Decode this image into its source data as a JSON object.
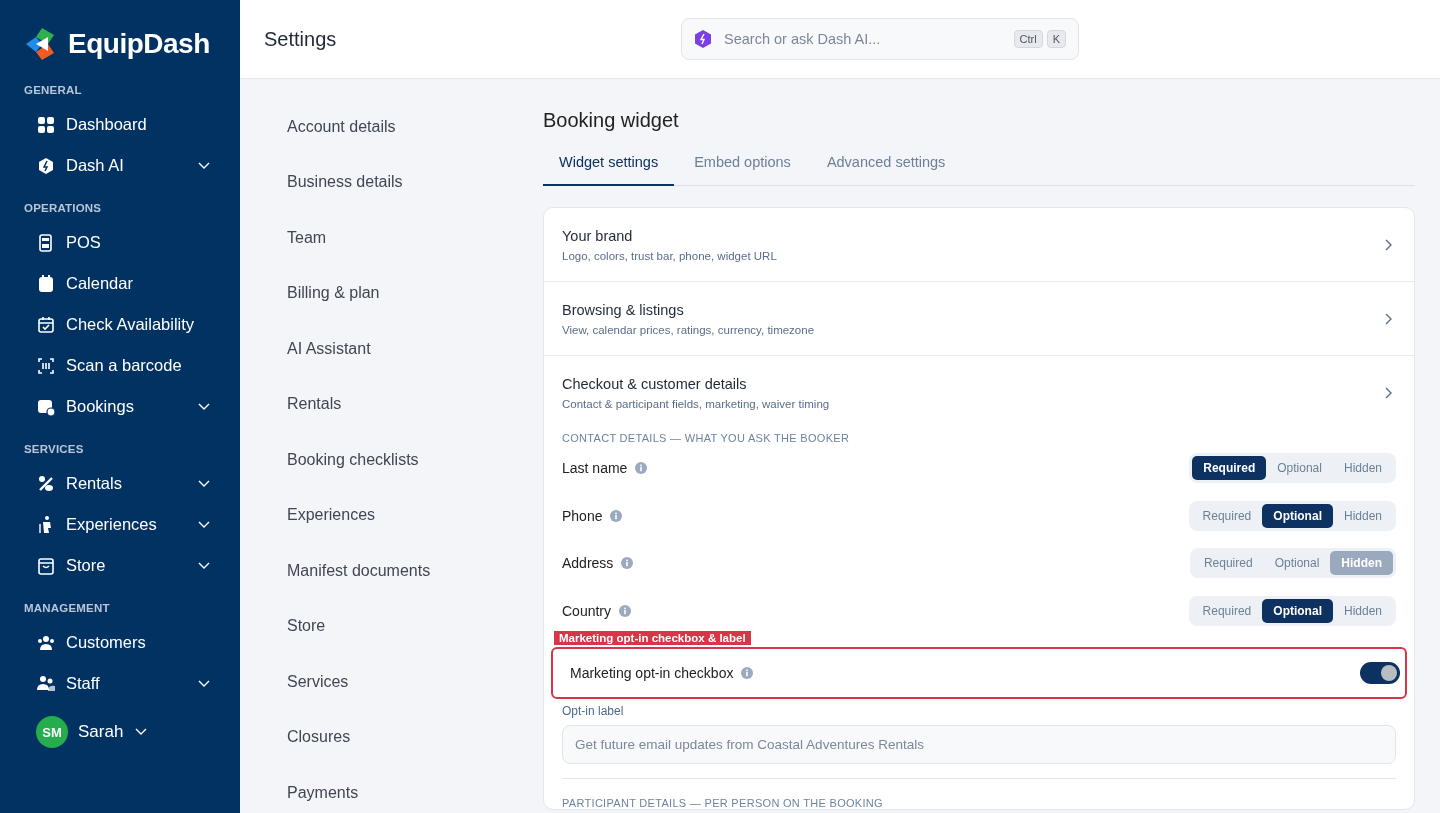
{
  "brand": {
    "name": "EquipDash"
  },
  "sidebar": {
    "sections": [
      {
        "title": "GENERAL",
        "items": [
          {
            "label": "Dashboard"
          },
          {
            "label": "Dash AI",
            "expanded": false
          }
        ]
      },
      {
        "title": "OPERATIONS",
        "items": [
          {
            "label": "POS"
          },
          {
            "label": "Calendar"
          },
          {
            "label": "Check Availability"
          },
          {
            "label": "Scan a barcode"
          },
          {
            "label": "Bookings",
            "expanded": false
          }
        ]
      },
      {
        "title": "SERVICES",
        "items": [
          {
            "label": "Rentals",
            "expanded": false
          },
          {
            "label": "Experiences",
            "expanded": false
          },
          {
            "label": "Store",
            "expanded": false
          }
        ]
      },
      {
        "title": "MANAGEMENT",
        "items": [
          {
            "label": "Customers"
          },
          {
            "label": "Staff",
            "expanded": false
          }
        ]
      }
    ],
    "user": {
      "initials": "SM",
      "name": "Sarah",
      "expanded": false
    }
  },
  "header": {
    "title": "Settings",
    "search": {
      "placeholder": "Search or ask Dash AI...",
      "keys": [
        "Ctrl",
        "K"
      ]
    }
  },
  "settings_nav": [
    "Account details",
    "Business details",
    "Team",
    "Billing & plan",
    "AI Assistant",
    "Rentals",
    "Booking checklists",
    "Experiences",
    "Manifest documents",
    "Store",
    "Services",
    "Closures",
    "Payments"
  ],
  "page": {
    "title": "Booking widget",
    "tabs": [
      {
        "label": "Widget settings",
        "selected": true
      },
      {
        "label": "Embed options",
        "selected": false
      },
      {
        "label": "Advanced settings",
        "selected": false
      }
    ],
    "panels": [
      {
        "title": "Your brand",
        "subtitle": "Logo, colors, trust bar, phone, widget URL"
      },
      {
        "title": "Browsing & listings",
        "subtitle": "View, calendar prices, ratings, currency, timezone"
      },
      {
        "title": "Checkout & customer details",
        "subtitle": "Contact & participant fields, marketing, waiver timing"
      }
    ],
    "contact_heading": "CONTACT DETAILS — WHAT YOU ASK THE BOOKER",
    "fields": [
      {
        "label": "Last name",
        "options": [
          {
            "label": "Required",
            "selected": true
          },
          {
            "label": "Optional",
            "selected": false
          },
          {
            "label": "Hidden",
            "selected": false
          }
        ]
      },
      {
        "label": "Phone",
        "options": [
          {
            "label": "Required",
            "selected": false
          },
          {
            "label": "Optional",
            "selected": true
          },
          {
            "label": "Hidden",
            "selected": false
          }
        ]
      },
      {
        "label": "Address",
        "options": [
          {
            "label": "Required",
            "selected": false
          },
          {
            "label": "Optional",
            "selected": false
          },
          {
            "label": "Hidden",
            "selected": true
          }
        ]
      },
      {
        "label": "Country",
        "options": [
          {
            "label": "Required",
            "selected": false
          },
          {
            "label": "Optional",
            "selected": true
          },
          {
            "label": "Hidden",
            "selected": false
          }
        ]
      }
    ],
    "annotation": "Marketing opt-in checkbox & label",
    "marketing": {
      "label": "Marketing opt-in checkbox",
      "on": true
    },
    "optin_label": {
      "label": "Opt-in label",
      "placeholder": "Get future email updates from Coastal Adventures Rentals"
    },
    "participant_heading": "PARTICIPANT DETAILS — PER PERSON ON THE BOOKING"
  }
}
